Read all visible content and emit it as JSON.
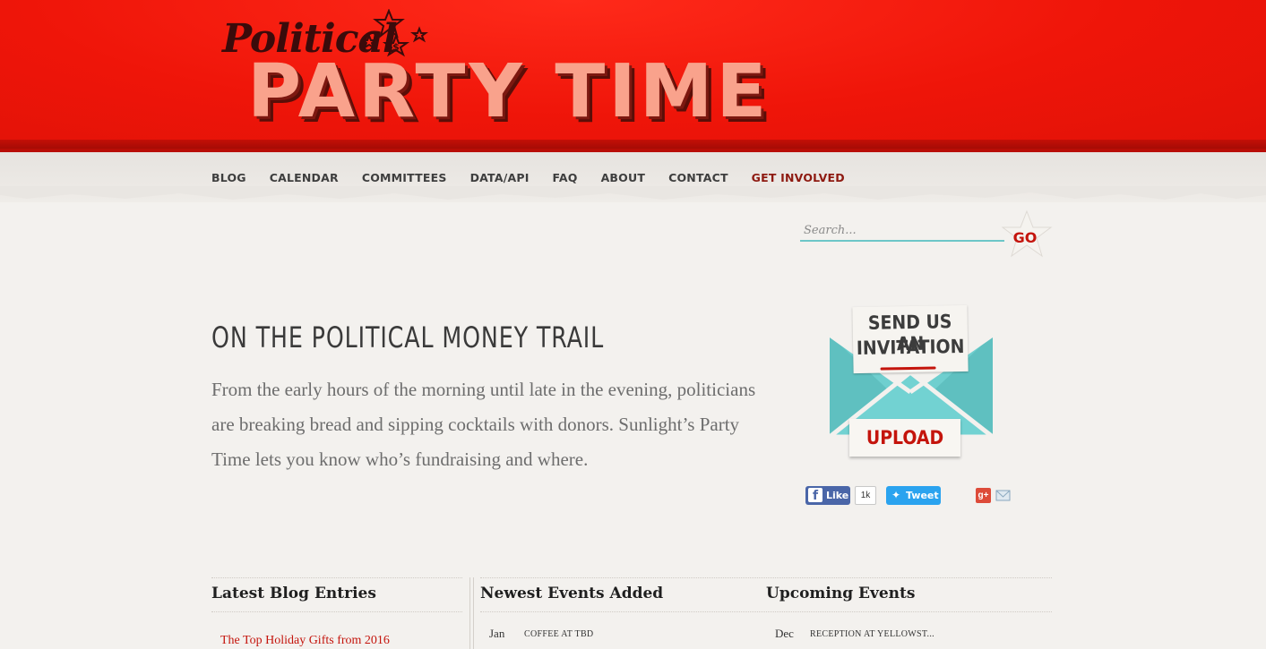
{
  "logo": {
    "line1": "Political",
    "line2": "PARTY TIME",
    "badge": "$"
  },
  "nav": {
    "items": [
      "BLOG",
      "CALENDAR",
      "COMMITTEES",
      "DATA/API",
      "FAQ",
      "ABOUT",
      "CONTACT",
      "GET INVOLVED"
    ]
  },
  "search": {
    "placeholder": "Search...",
    "button_label": "GO"
  },
  "hero": {
    "title": "ON THE POLITICAL MONEY TRAIL",
    "text": "From the early hours of the morning until late in the evening, politicians are breaking bread and sipping cocktails with donors. Sunlight’s Party Time lets you know who’s fundraising and where."
  },
  "invitation": {
    "line1": "SEND US AN",
    "line2": "INVITATION",
    "button_label": "UPLOAD"
  },
  "social": {
    "like_label": "Like",
    "like_count": "1k",
    "tweet_label": "Tweet",
    "gplus_label": "g+"
  },
  "sections": {
    "blog": {
      "heading": "Latest Blog Entries",
      "first_entry": "The Top Holiday Gifts from 2016"
    },
    "newest": {
      "heading": "Newest Events Added",
      "first_month": "Jan",
      "first_event": "COFFEE AT TBD"
    },
    "upcoming": {
      "heading": "Upcoming Events",
      "first_month": "Dec",
      "first_event": "RECEPTION AT YELLOWST..."
    }
  },
  "colors": {
    "header_red": "#ef1509",
    "accent_red": "#c4140c",
    "teal": "#6cc6c8",
    "background": "#f3f1ee"
  }
}
